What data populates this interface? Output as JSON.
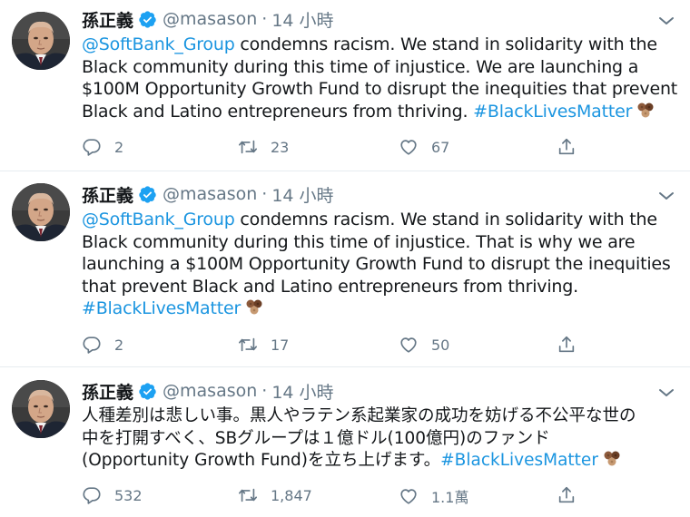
{
  "tweets": [
    {
      "display_name": "孫正義",
      "handle": "@masason",
      "dot": "·",
      "time": "14 小時",
      "mention": "@SoftBank_Group",
      "line1_rest": " condemns racism. We stand in solidarity with the",
      "line2": "Black community during this time of injustice. We are launching a",
      "line3": "$100M Opportunity Growth Fund to disrupt the inequities that prevent",
      "line4_text": "Black and Latino entrepreneurs from thriving. ",
      "line5_text": "",
      "hashtag": "#BlackLivesMatter",
      "replies": "2",
      "retweets": "23",
      "likes": "67"
    },
    {
      "display_name": "孫正義",
      "handle": "@masason",
      "dot": "·",
      "time": "14 小時",
      "mention": "@SoftBank_Group",
      "line1_rest": " condemns racism. We stand in solidarity with the",
      "line2": "Black community during this time of injustice. That is why we are",
      "line3": "launching a $100M Opportunity Growth Fund to disrupt the inequities",
      "line4_text": "that prevent Black and Latino entrepreneurs from thriving.",
      "hashtag": "#BlackLivesMatter",
      "replies": "2",
      "retweets": "17",
      "likes": "50"
    },
    {
      "display_name": "孫正義",
      "handle": "@masason",
      "dot": "·",
      "time": "14 小時",
      "line1": "人種差別は悲しい事。黒人やラテン系起業家の成功を妨げる不公平な世の",
      "line2": "中を打開すべく、SBグループは１億ドル(100億円)のファンド",
      "line3_text": "(Opportunity Growth Fund)を立ち上げます。",
      "hashtag": "#BlackLivesMatter",
      "replies": "532",
      "retweets": "1,847",
      "likes": "1.1萬"
    }
  ],
  "colors": {
    "link": "#1b95e0",
    "secondary_text": "#657786",
    "primary_text": "#14171a",
    "verified": "#1da1f2",
    "divider": "#e6ecf0"
  },
  "icons": [
    "verified-badge-icon",
    "chevron-down-icon",
    "reply-icon",
    "retweet-icon",
    "like-icon",
    "share-icon",
    "raised-fist-emoji"
  ]
}
